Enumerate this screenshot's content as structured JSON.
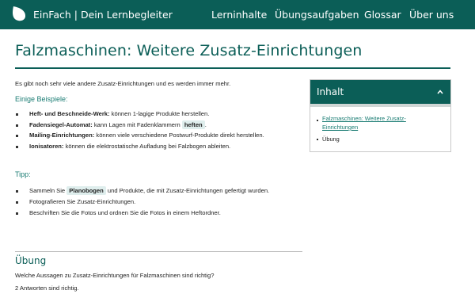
{
  "header": {
    "brand": "EinFach | Dein Lernbegleiter",
    "nav": [
      "Lerninhalte",
      "Übungsaufgaben",
      "Glossar",
      "Über uns"
    ]
  },
  "page": {
    "title": "Falzmaschinen: Weitere Zusatz-Einrichtungen",
    "intro": "Es gibt noch sehr viele andere Zusatz-Einrichtungen und es werden immer mehr.",
    "examples_heading": "Einige Beispiele:",
    "examples": [
      {
        "term": "Heft- und Beschneide-Werk:",
        "text": "können 1-lagige Produkte herstellen.",
        "keyword": "",
        "after": ""
      },
      {
        "term": "Fadensiegel-Automat:",
        "text": "kann Lagen mit Fadenklammern",
        "keyword": "heften",
        "after": "."
      },
      {
        "term": "Mailing-Einrichtungen:",
        "text": "können viele verschiedene Postwurf-Produkte direkt herstellen.",
        "keyword": "",
        "after": ""
      },
      {
        "term": "Ionisatoren:",
        "text": "können die elektrostatische Aufladung bei Falzbogen ableiten.",
        "keyword": "",
        "after": ""
      }
    ],
    "tip_heading": "Tipp:",
    "tips": [
      {
        "before": "Sammeln Sie",
        "keyword": "Planobogen",
        "after": "und Produkte, die mit Zusatz-Einrichtungen gefertigt wurden."
      },
      {
        "before": "Fotografieren Sie Zusatz-Einrichtungen.",
        "keyword": "",
        "after": ""
      },
      {
        "before": "Beschriften Sie die Fotos und ordnen Sie die Fotos in einem Heftordner.",
        "keyword": "",
        "after": ""
      }
    ]
  },
  "toc": {
    "title": "Inhalt",
    "items": [
      {
        "line1": "Falzmaschinen: Weitere Zusatz-",
        "line2": "Einrichtungen"
      },
      {
        "line1": "Übung",
        "line2": ""
      }
    ]
  },
  "exercise": {
    "title": "Übung",
    "question": "Welche Aussagen zu Zusatz-Einrichtungen für Falzmaschinen sind richtig?",
    "hint": "2 Antworten sind richtig."
  },
  "colors": {
    "primary": "#0b5e57",
    "accent": "#1a7c73",
    "highlight": "#dfeeed"
  }
}
